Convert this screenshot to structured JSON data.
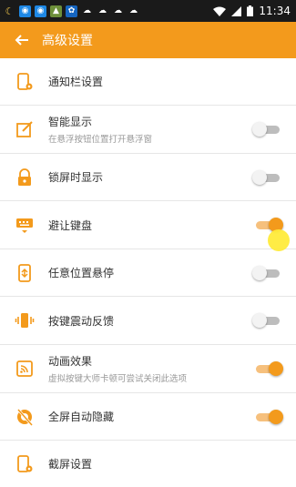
{
  "status_bar": {
    "time": "11:34",
    "icons": [
      "moon-icon",
      "app-icon",
      "app-icon",
      "image-icon",
      "settings-icon",
      "cloud-icon",
      "cloud-icon",
      "cloud-icon",
      "cloud-icon"
    ]
  },
  "header": {
    "title": "高级设置",
    "bg_color": "#f39a1c"
  },
  "settings": [
    {
      "label": "通知栏设置",
      "sub": "",
      "toggle": null
    },
    {
      "label": "智能显示",
      "sub": "在悬浮按钮位置打开悬浮窗",
      "toggle": "off"
    },
    {
      "label": "锁屏时显示",
      "sub": "",
      "toggle": "off"
    },
    {
      "label": "避让键盘",
      "sub": "",
      "toggle": "on"
    },
    {
      "label": "任意位置悬停",
      "sub": "",
      "toggle": "off"
    },
    {
      "label": "按键震动反馈",
      "sub": "",
      "toggle": "off"
    },
    {
      "label": "动画效果",
      "sub": "虚拟按键大师卡顿可尝试关闭此选项",
      "toggle": "on"
    },
    {
      "label": "全屏自动隐藏",
      "sub": "",
      "toggle": "on"
    },
    {
      "label": "截屏设置",
      "sub": "",
      "toggle": null
    }
  ]
}
